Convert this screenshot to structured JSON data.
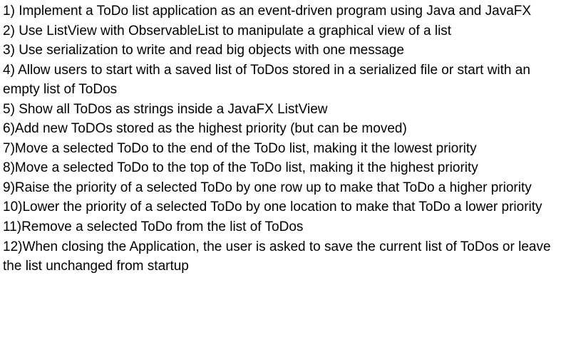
{
  "items": [
    {
      "num": "1) ",
      "text": "Implement a ToDo list application as an event-driven program using Java and JavaFX"
    },
    {
      "num": "2) ",
      "text": "Use ListView with ObservableList to manipulate a graphical view of a list"
    },
    {
      "num": "3) ",
      "text": "Use serialization to write and read big objects with one message"
    },
    {
      "num": "4) ",
      "text": "Allow users to start with a saved list of ToDos stored in a serialized file or start with an empty list of ToDos"
    },
    {
      "num": "5) ",
      "text": "Show all ToDos as strings inside a JavaFX ListView"
    },
    {
      "num": "6)",
      "text": "Add new ToDOs stored as the highest priority (but can be moved)"
    },
    {
      "num": "7)",
      "text": "Move a selected ToDo to the end of the ToDo list,  making it the lowest priority"
    },
    {
      "num": "8)",
      "text": "Move a selected ToDo to the top of the ToDo list, making it the highest priority"
    },
    {
      "num": "9)",
      "text": "Raise the priority of a selected ToDo by one row up to make that ToDo a higher priority"
    },
    {
      "num": "10)",
      "text": "Lower the priority of a selected ToDo by one location to make that ToDo a lower priority"
    },
    {
      "num": "11)",
      "text": "Remove a selected ToDo from the list of ToDos"
    },
    {
      "num": "12)",
      "text": "When closing the Application, the user is asked to save the current list of ToDos or leave the list unchanged from startup"
    }
  ]
}
